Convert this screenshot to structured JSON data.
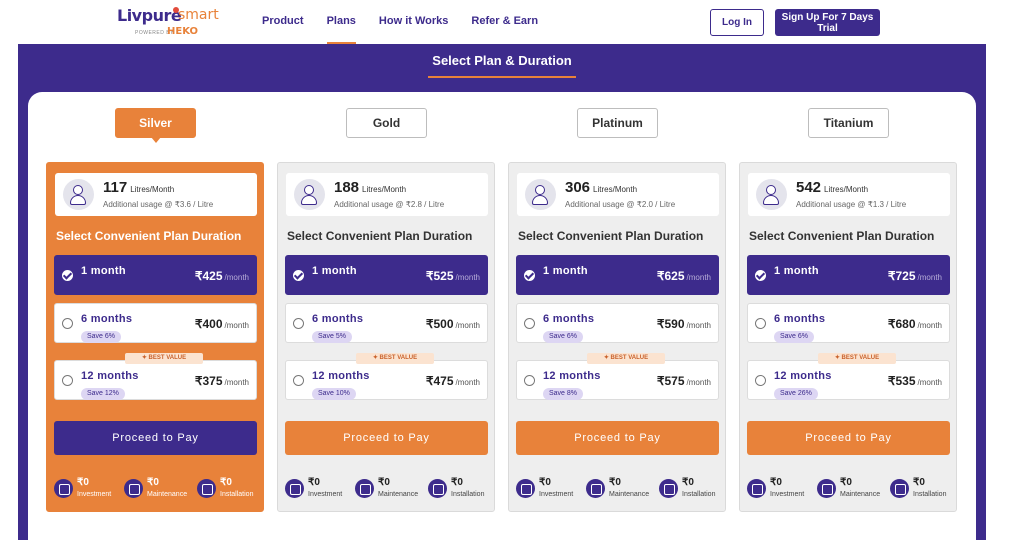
{
  "brand": {
    "name": "Livpure",
    "smart": "smart",
    "powered_by": "POWERED BY",
    "heko": "HEKO"
  },
  "nav": [
    {
      "label": "Product",
      "active": false
    },
    {
      "label": "Plans",
      "active": true
    },
    {
      "label": "How it Works",
      "active": false
    },
    {
      "label": "Refer & Earn",
      "active": false
    }
  ],
  "header": {
    "login_label": "Log In",
    "signup_label": "Sign Up For 7 Days Trial"
  },
  "section_title": "Select Plan & Duration",
  "tabs": [
    {
      "label": "Silver",
      "active": true
    },
    {
      "label": "Gold",
      "active": false
    },
    {
      "label": "Platinum",
      "active": false
    },
    {
      "label": "Titanium",
      "active": false
    }
  ],
  "plans": [
    {
      "liters": "117",
      "unit": "Litres/Month",
      "extra": "Additional usage @ ₹3.6 / Litre",
      "duration_title": "Select Convenient Plan Duration",
      "options": [
        {
          "label": "1 month",
          "price": "₹425",
          "per": "/month",
          "save": ""
        },
        {
          "label": "6 months",
          "price": "₹400",
          "per": "/month",
          "save": "Save 6%"
        },
        {
          "label": "12 months",
          "price": "₹375",
          "per": "/month",
          "save": "Save 12%",
          "badge": "✦ BEST VALUE"
        }
      ],
      "pay_label": "Proceed to Pay",
      "features": [
        {
          "value": "₹0",
          "label": "Investment",
          "icon": "investment-icon"
        },
        {
          "value": "₹0",
          "label": "Maintenance",
          "icon": "maintenance-icon"
        },
        {
          "value": "₹0",
          "label": "Installation",
          "icon": "installation-icon"
        }
      ]
    },
    {
      "liters": "188",
      "unit": "Litres/Month",
      "extra": "Additional usage @ ₹2.8 / Litre",
      "duration_title": "Select Convenient Plan Duration",
      "options": [
        {
          "label": "1 month",
          "price": "₹525",
          "per": "/month",
          "save": ""
        },
        {
          "label": "6 months",
          "price": "₹500",
          "per": "/month",
          "save": "Save 5%"
        },
        {
          "label": "12 months",
          "price": "₹475",
          "per": "/month",
          "save": "Save 10%",
          "badge": "✦ BEST VALUE"
        }
      ],
      "pay_label": "Proceed to Pay",
      "features": [
        {
          "value": "₹0",
          "label": "Investment",
          "icon": "investment-icon"
        },
        {
          "value": "₹0",
          "label": "Maintenance",
          "icon": "maintenance-icon"
        },
        {
          "value": "₹0",
          "label": "Installation",
          "icon": "installation-icon"
        }
      ]
    },
    {
      "liters": "306",
      "unit": "Litres/Month",
      "extra": "Additional usage @ ₹2.0 / Litre",
      "duration_title": "Select Convenient Plan Duration",
      "options": [
        {
          "label": "1 month",
          "price": "₹625",
          "per": "/month",
          "save": ""
        },
        {
          "label": "6 months",
          "price": "₹590",
          "per": "/month",
          "save": "Save 6%"
        },
        {
          "label": "12 months",
          "price": "₹575",
          "per": "/month",
          "save": "Save 8%",
          "badge": "✦ BEST VALUE"
        }
      ],
      "pay_label": "Proceed to Pay",
      "features": [
        {
          "value": "₹0",
          "label": "Investment",
          "icon": "investment-icon"
        },
        {
          "value": "₹0",
          "label": "Maintenance",
          "icon": "maintenance-icon"
        },
        {
          "value": "₹0",
          "label": "Installation",
          "icon": "installation-icon"
        }
      ]
    },
    {
      "liters": "542",
      "unit": "Litres/Month",
      "extra": "Additional usage @ ₹1.3 / Litre",
      "duration_title": "Select Convenient Plan Duration",
      "options": [
        {
          "label": "1 month",
          "price": "₹725",
          "per": "/month",
          "save": ""
        },
        {
          "label": "6 months",
          "price": "₹680",
          "per": "/month",
          "save": "Save 6%"
        },
        {
          "label": "12 months",
          "price": "₹535",
          "per": "/month",
          "save": "Save 26%",
          "badge": "✦ BEST VALUE"
        }
      ],
      "pay_label": "Proceed to Pay",
      "features": [
        {
          "value": "₹0",
          "label": "Investment",
          "icon": "investment-icon"
        },
        {
          "value": "₹0",
          "label": "Maintenance",
          "icon": "maintenance-icon"
        },
        {
          "value": "₹0",
          "label": "Installation",
          "icon": "installation-icon"
        }
      ]
    }
  ],
  "colors": {
    "brand_purple": "#3d2b8c",
    "accent_orange": "#e8823a"
  }
}
